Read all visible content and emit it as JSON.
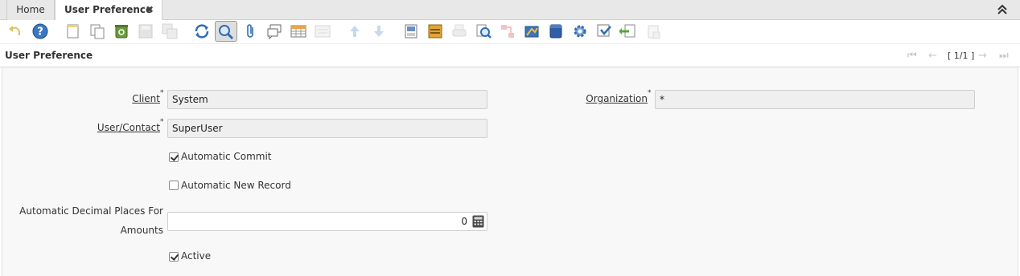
{
  "tabs": {
    "home": "Home",
    "active": "User Preference",
    "close": "✖"
  },
  "window": {
    "title": "User Preference",
    "pager": "[ 1/1 ]"
  },
  "toolbar": {
    "icons": [
      "undo-icon",
      "help-icon",
      "new-record-icon",
      "copy-record-icon",
      "delete-icon",
      "save-icon",
      "save-new-icon",
      "refresh-icon",
      "find-icon",
      "attachment-icon",
      "chat-icon",
      "grid-toggle-icon",
      "multi-edit-icon",
      "parent-record-icon",
      "detail-record-icon",
      "report-icon",
      "archive-icon",
      "print-icon",
      "zoom-across-icon",
      "workflow-icon",
      "request-icon",
      "product-info-icon",
      "process-icon",
      "customize-icon",
      "export-icon",
      "import-icon",
      "post-delete-icon"
    ]
  },
  "form": {
    "client": {
      "label": "Client",
      "value": "System"
    },
    "organization": {
      "label": "Organization",
      "value": "*"
    },
    "user_contact": {
      "label": "User/Contact",
      "value": "SuperUser"
    },
    "auto_commit": {
      "label": "Automatic Commit",
      "checked": true
    },
    "auto_new_record": {
      "label": "Automatic New Record",
      "checked": false
    },
    "decimal_places": {
      "label_line1": "Automatic Decimal Places For",
      "label_line2": "Amounts",
      "value": "0"
    },
    "active": {
      "label": "Active",
      "checked": true
    },
    "mandatory_mark": "*"
  },
  "colors": {
    "accent_blue": "#2f6db5",
    "field_bg": "#efefef",
    "form_bg": "#f8f8f8"
  }
}
